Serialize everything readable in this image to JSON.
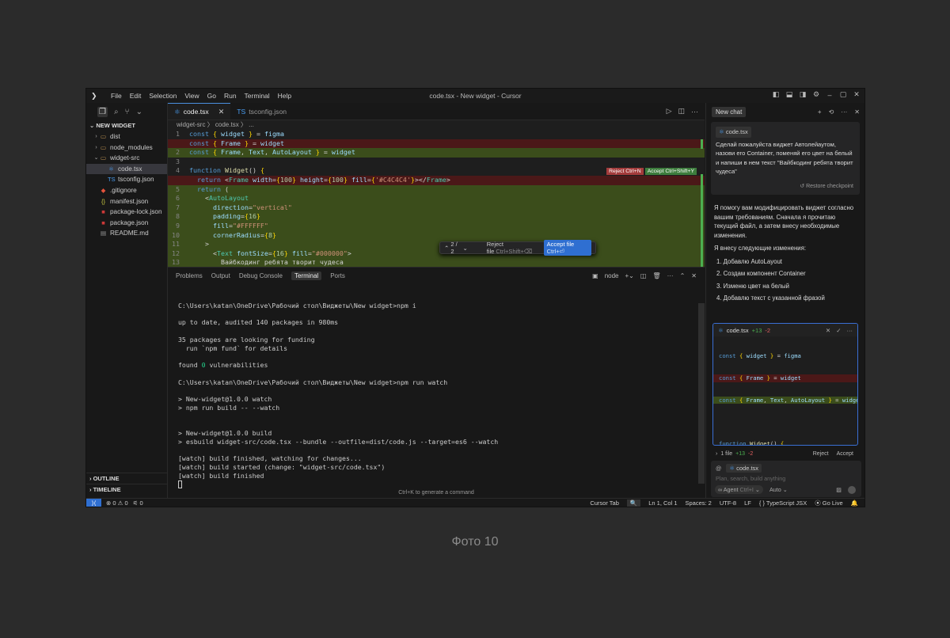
{
  "window": {
    "title": "code.tsx - New widget - Cursor",
    "menu": [
      "File",
      "Edit",
      "Selection",
      "View",
      "Go",
      "Run",
      "Terminal",
      "Help"
    ]
  },
  "explorer": {
    "header": "NEW WIDGET",
    "items": [
      {
        "label": "dist",
        "type": "folder",
        "open": false,
        "indent": 0
      },
      {
        "label": "node_modules",
        "type": "folder",
        "open": false,
        "indent": 0
      },
      {
        "label": "widget-src",
        "type": "folder",
        "open": true,
        "indent": 0
      },
      {
        "label": "code.tsx",
        "type": "tsx",
        "indent": 1,
        "selected": true
      },
      {
        "label": "tsconfig.json",
        "type": "tsconfig",
        "indent": 1
      },
      {
        "label": ".gitignore",
        "type": "git",
        "indent": 0
      },
      {
        "label": "manifest.json",
        "type": "json",
        "indent": 0
      },
      {
        "label": "package-lock.json",
        "type": "npm",
        "indent": 0
      },
      {
        "label": "package.json",
        "type": "npm",
        "indent": 0
      },
      {
        "label": "README.md",
        "type": "md",
        "indent": 0
      }
    ],
    "outline": "OUTLINE",
    "timeline": "TIMELINE"
  },
  "editor": {
    "tabs": [
      {
        "label": "code.tsx",
        "active": true
      },
      {
        "label": "tsconfig.json",
        "active": false
      }
    ],
    "breadcrumb": "widget-src  〉 code.tsx 〉 ...",
    "reject_inline": "Reject Ctrl+N",
    "accept_inline": "Accept Ctrl+Shift+Y",
    "review": {
      "counter": "2 / 2",
      "reject": "Reject file",
      "reject_kbd": "Ctrl+Shift+⌫",
      "accept": "Accept file",
      "accept_kbd": "Ctrl+⏎"
    }
  },
  "panel": {
    "tabs": [
      "Problems",
      "Output",
      "Debug Console",
      "Terminal",
      "Ports"
    ],
    "active_tab": "Terminal",
    "shell": "node",
    "terminal_lines": [
      "",
      "C:\\Users\\katan\\OneDrive\\Рабочий стол\\Виджеты\\New widget>npm i",
      "",
      "up to date, audited 140 packages in 980ms",
      "",
      "35 packages are looking for funding",
      "  run `npm fund` for details",
      "",
      "found 0 vulnerabilities",
      "",
      "C:\\Users\\katan\\OneDrive\\Рабочий стол\\Виджеты\\New widget>npm run watch",
      "",
      "> New-widget@1.0.0 watch",
      "> npm run build -- --watch",
      "",
      "",
      "> New-widget@1.0.0 build",
      "> esbuild widget-src/code.tsx --bundle --outfile=dist/code.js --target=es6 --watch",
      "",
      "[watch] build finished, watching for changes...",
      "[watch] build started (change: \"widget-src/code.tsx\")",
      "[watch] build finished"
    ],
    "hint": "Ctrl+K to generate a command"
  },
  "chat": {
    "new_chat": "New chat",
    "user_file_chip": "code.tsx",
    "user_message": "Сделай пожалуйста виджет Автолейаутом, назови его Container, поменяй его цвет на белый и напиши в нем текст \"Вайбкодинг ребята творит чудеса\"",
    "restore": "Restore checkpoint",
    "assistant_intro": "Я помогу вам модифицировать виджет согласно вашим требованиям. Сначала я прочитаю текущий файл, а затем внесу необходимые изменения.",
    "assistant_list_title": "Я внесу следующие изменения:",
    "assistant_list": [
      "1. Добавлю AutoLayout",
      "2. Создам компонент Container",
      "3. Изменю цвет на белый",
      "4. Добавлю текст с указанной фразой"
    ],
    "diff_file": "code.tsx",
    "diff_plus": "+13",
    "diff_minus": "-2",
    "files_summary": "1 file",
    "reject": "Reject",
    "accept": "Accept",
    "input_chip": "code.tsx",
    "input_placeholder": "Plan, search, build anything",
    "agent_label": "Agent",
    "agent_kbd": "Ctrl+I",
    "model_label": "Auto"
  },
  "status": {
    "errors": "0",
    "warnings": "0",
    "ports": "0",
    "cursor_tab": "Cursor Tab",
    "position": "Ln 1, Col 1",
    "spaces": "Spaces: 2",
    "encoding": "UTF-8",
    "eol": "LF",
    "language": "TypeScript JSX",
    "golive": "Go Live"
  },
  "caption": "Фото 10",
  "colors": {
    "accent": "#2f6fd1",
    "del_bg": "#4b1818",
    "add_bg": "#3b4d1b"
  }
}
